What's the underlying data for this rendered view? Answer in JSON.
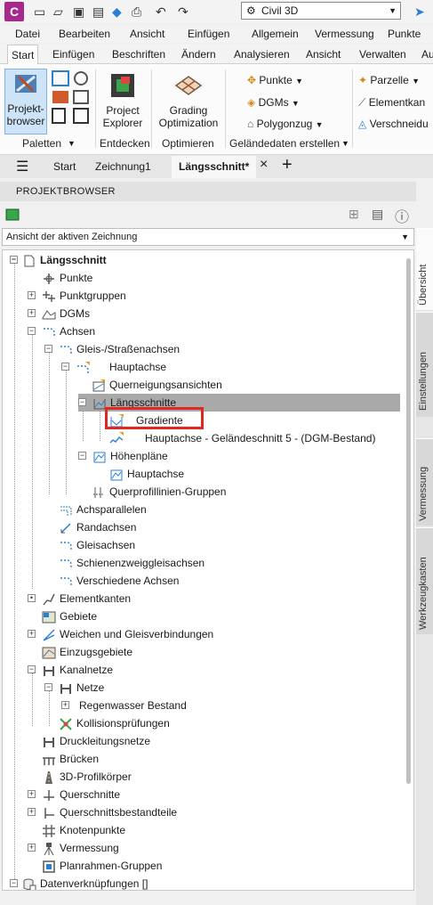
{
  "app": {
    "logo": "C",
    "workspace": "Civil 3D"
  },
  "menubar": [
    "Datei",
    "Bearbeiten",
    "Ansicht",
    "Einfügen",
    "Allgemein",
    "Vermessung",
    "Punkte"
  ],
  "ribbon_tabs": [
    "Start",
    "Einfügen",
    "Beschriften",
    "Ändern",
    "Analysieren",
    "Ansicht",
    "Verwalten",
    "Ausgabe"
  ],
  "ribbon": {
    "projektbrowser": [
      "Projekt-",
      "browser"
    ],
    "paletten": "Paletten",
    "project_explorer": [
      "Project",
      "Explorer"
    ],
    "entdecken": "Entdecken",
    "grading": [
      "Grading",
      "Optimization"
    ],
    "optimieren": "Optimieren",
    "punkte": "Punkte",
    "dgms": "DGMs",
    "polygonzug": "Polygonzug",
    "gelaende": "Geländedaten erstellen",
    "parzelle": "Parzelle",
    "elementkanten": "Elementkan",
    "verschneidung": "Verschneidu"
  },
  "doc_tabs": [
    "Start",
    "Zeichnung1",
    "Längsschnitt*"
  ],
  "browser": {
    "title": "PROJEKTBROWSER",
    "view_select": "Ansicht der aktiven Zeichnung"
  },
  "tree": [
    {
      "label": "Längsschnitt",
      "icon": "drawing-icon"
    },
    {
      "label": "Punkte",
      "icon": "points-icon"
    },
    {
      "label": "Punktgruppen",
      "icon": "point-groups-icon"
    },
    {
      "label": "DGMs",
      "icon": "surfaces-icon"
    },
    {
      "label": "Achsen",
      "icon": "alignments-icon"
    },
    {
      "label": "Gleis-/Straßenachsen",
      "icon": "alignment-icon"
    },
    {
      "label": "Hauptachse",
      "icon": "alignment-icon"
    },
    {
      "label": "Querneigungsansichten",
      "icon": "superelevation-icon"
    },
    {
      "label": "Längsschnitte",
      "icon": "profile-icon"
    },
    {
      "label": "Gradiente",
      "icon": "profile-icon"
    },
    {
      "label": "Hauptachse - Geländeschnitt 5 - (DGM-Bestand)",
      "icon": "surface-profile-icon"
    },
    {
      "label": "Höhenpläne",
      "icon": "profile-view-icon"
    },
    {
      "label": "Hauptachse",
      "icon": "profile-view-icon"
    },
    {
      "label": "Querprofillinien-Gruppen",
      "icon": "sample-lines-icon"
    },
    {
      "label": "Achsparallelen",
      "icon": "offset-icon"
    },
    {
      "label": "Randachsen",
      "icon": "curb-icon"
    },
    {
      "label": "Gleisachsen",
      "icon": "rail-icon"
    },
    {
      "label": "Schienenzweiggleisachsen",
      "icon": "rail-branch-icon"
    },
    {
      "label": "Verschiedene Achsen",
      "icon": "misc-alignment-icon"
    },
    {
      "label": "Elementkanten",
      "icon": "feature-lines-icon"
    },
    {
      "label": "Gebiete",
      "icon": "sites-icon"
    },
    {
      "label": "Weichen und Gleisverbindungen",
      "icon": "turnouts-icon"
    },
    {
      "label": "Einzugsgebiete",
      "icon": "catchments-icon"
    },
    {
      "label": "Kanalnetze",
      "icon": "pipe-networks-icon"
    },
    {
      "label": "Netze",
      "icon": "network-icon"
    },
    {
      "label": "Regenwasser Bestand",
      "icon": "network-item-icon"
    },
    {
      "label": "Kollisionsprüfungen",
      "icon": "interference-icon"
    },
    {
      "label": "Druckleitungsnetze",
      "icon": "pressure-networks-icon"
    },
    {
      "label": "Brücken",
      "icon": "bridges-icon"
    },
    {
      "label": "3D-Profilkörper",
      "icon": "corridors-icon"
    },
    {
      "label": "Querschnitte",
      "icon": "assemblies-icon"
    },
    {
      "label": "Querschnittsbestandteile",
      "icon": "subassemblies-icon"
    },
    {
      "label": "Knotenpunkte",
      "icon": "intersections-icon"
    },
    {
      "label": "Vermessung",
      "icon": "survey-icon"
    },
    {
      "label": "Planrahmen-Gruppen",
      "icon": "view-frames-icon"
    },
    {
      "label": "Datenverknüpfungen []",
      "icon": "data-shortcuts-icon"
    }
  ],
  "side_tabs": [
    "Übersicht",
    "Einstellungen",
    "Vermessung",
    "Werkzeugkasten"
  ],
  "colors": {
    "selection_outline": "#e0281e",
    "accent": "#2a7fd4",
    "logo": "#a52a8c"
  }
}
